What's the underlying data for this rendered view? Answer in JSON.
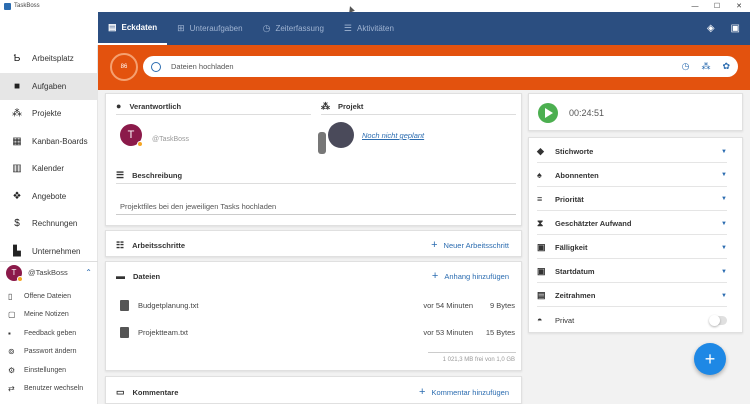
{
  "window": {
    "title": "TaskBoss"
  },
  "header": {
    "tabs": [
      {
        "label": "Eckdaten",
        "icon": "book-icon"
      },
      {
        "label": "Unteraufgaben",
        "icon": "subtasks-icon"
      },
      {
        "label": "Zeiterfassung",
        "icon": "clock-icon"
      },
      {
        "label": "Aktivitäten",
        "icon": "activity-icon"
      }
    ]
  },
  "sidebar": {
    "items": [
      {
        "label": "Arbeitsplatz",
        "icon": "workspace-icon"
      },
      {
        "label": "Aufgaben",
        "icon": "box-icon"
      },
      {
        "label": "Projekte",
        "icon": "projects-icon"
      },
      {
        "label": "Kanban-Boards",
        "icon": "kanban-icon"
      },
      {
        "label": "Kalender",
        "icon": "calendar-icon"
      },
      {
        "label": "Angebote",
        "icon": "offers-icon"
      },
      {
        "label": "Rechnungen",
        "icon": "dollar-icon"
      },
      {
        "label": "Unternehmen",
        "icon": "building-icon"
      }
    ],
    "user": {
      "name": "@TaskBoss",
      "initial": "T"
    },
    "links": [
      {
        "label": "Offene Dateien",
        "icon": "file-icon"
      },
      {
        "label": "Meine Notizen",
        "icon": "notes-icon"
      },
      {
        "label": "Feedback geben",
        "icon": "feedback-icon"
      },
      {
        "label": "Passwort ändern",
        "icon": "key-icon"
      },
      {
        "label": "Einstellungen",
        "icon": "gear-icon"
      },
      {
        "label": "Benutzer wechseln",
        "icon": "switch-user-icon"
      }
    ]
  },
  "task": {
    "badge": "86",
    "upload_placeholder": "Dateien hochladen"
  },
  "details": {
    "responsible_label": "Verantwortlich",
    "responsible_user": "@TaskBoss",
    "responsible_initial": "T",
    "project_label": "Projekt",
    "project_value": "Noch nicht geplant",
    "description_label": "Beschreibung",
    "description_text": "Projektfiles bei den jeweiligen Tasks hochladen"
  },
  "steps": {
    "label": "Arbeitsschritte",
    "add_label": "Neuer Arbeitsschritt"
  },
  "files": {
    "label": "Dateien",
    "add_label": "Anhang hinzufügen",
    "rows": [
      {
        "name": "Budgetplanung.txt",
        "time": "vor 54 Minuten",
        "size": "9 Bytes"
      },
      {
        "name": "Projektteam.txt",
        "time": "vor 53 Minuten",
        "size": "15 Bytes"
      }
    ],
    "quota": "1 021,3 MB frei von 1,0 GB"
  },
  "comments": {
    "label": "Kommentare",
    "add_label": "Kommentar hinzufügen"
  },
  "timer": {
    "value": "00:24:51"
  },
  "properties": [
    {
      "label": "Stichworte",
      "icon": "tag-icon"
    },
    {
      "label": "Abonnenten",
      "icon": "bell-icon"
    },
    {
      "label": "Priorität",
      "icon": "priority-icon"
    },
    {
      "label": "Geschätzter Aufwand",
      "icon": "hourglass-icon"
    },
    {
      "label": "Fälligkeit",
      "icon": "due-date-icon"
    },
    {
      "label": "Startdatum",
      "icon": "start-date-icon"
    },
    {
      "label": "Zeitrahmen",
      "icon": "timeframe-icon"
    }
  ],
  "private": {
    "label": "Privat",
    "icon": "incognito-icon",
    "enabled": false
  }
}
